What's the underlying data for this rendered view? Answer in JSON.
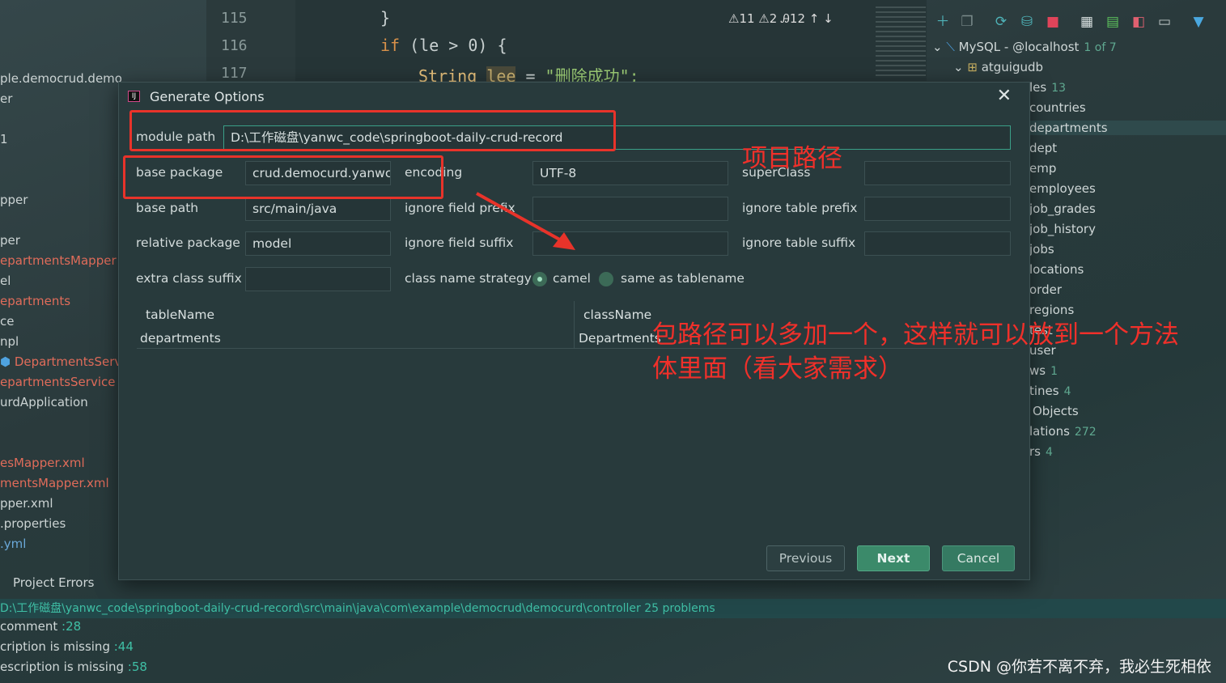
{
  "left_tree": [
    {
      "text": "ple.democrud.democurd",
      "color": "normal"
    },
    {
      "text": "er",
      "color": "normal"
    },
    {
      "text": "1",
      "color": "normal"
    },
    {
      "text": "pper",
      "color": "normal"
    },
    {
      "text": "per",
      "color": "normal"
    },
    {
      "text": "epartmentsMapper",
      "color": "red"
    },
    {
      "text": "el",
      "color": "normal"
    },
    {
      "text": "epartments",
      "color": "red"
    },
    {
      "text": "ce",
      "color": "normal"
    },
    {
      "text": "npl",
      "color": "normal"
    },
    {
      "text": "DepartmentsServic",
      "color": "red"
    },
    {
      "text": "epartmentsService",
      "color": "red"
    },
    {
      "text": "urdApplication",
      "color": "normal"
    },
    {
      "text": "esMapper.xml",
      "color": "red"
    },
    {
      "text": "mentsMapper.xml",
      "color": "red"
    },
    {
      "text": "pper.xml",
      "color": "normal"
    },
    {
      "text": ".properties",
      "color": "normal"
    },
    {
      "text": ".yml",
      "color": "blue"
    }
  ],
  "editor": {
    "line_numbers": [
      "115",
      "116",
      "117"
    ],
    "line1": "}",
    "line2_kw": "if",
    "line2_rest": " (le > 0) {",
    "line3_type": "String",
    "line3_var": "lee",
    "line3_eq": " = ",
    "line3_str": "\"删除成功\";",
    "warnings": "⚠11  ⚠2  Ꭿ12  ↑  ↓"
  },
  "db_panel": {
    "connection": "MySQL - @localhost",
    "connection_count": "1 of 7",
    "schema": "atguigudb",
    "items": [
      {
        "text": "les",
        "count": "13"
      },
      {
        "text": "countries",
        "count": ""
      },
      {
        "text": "departments",
        "count": "",
        "selected": true
      },
      {
        "text": "dept",
        "count": ""
      },
      {
        "text": "emp",
        "count": ""
      },
      {
        "text": "employees",
        "count": ""
      },
      {
        "text": "job_grades",
        "count": ""
      },
      {
        "text": "job_history",
        "count": ""
      },
      {
        "text": "jobs",
        "count": ""
      },
      {
        "text": "locations",
        "count": ""
      },
      {
        "text": "order",
        "count": ""
      },
      {
        "text": "regions",
        "count": ""
      },
      {
        "text": "test",
        "count": ""
      },
      {
        "text": "user",
        "count": ""
      },
      {
        "text": "ws",
        "count": "1"
      },
      {
        "text": "tines",
        "count": "4"
      },
      {
        "text": "Objects",
        "count": ""
      },
      {
        "text": "lations",
        "count": "272"
      },
      {
        "text": "rs",
        "count": "4"
      }
    ]
  },
  "bottom": {
    "tab": "Project Errors",
    "path": "D:\\工作磁盘\\yanwc_code\\springboot-daily-crud-record\\src\\main\\java\\com\\example\\democrud\\democurd\\controller  25 problems",
    "errors": [
      {
        "text": "comment",
        "line": ":28"
      },
      {
        "text": "cription is missing",
        "line": ":44"
      },
      {
        "text": "escription is missing",
        "line": ":58"
      }
    ]
  },
  "dialog": {
    "title": "Generate Options",
    "close": "✕",
    "module_path_label": "module path",
    "module_path_value": "D:\\工作磁盘\\yanwc_code\\springboot-daily-crud-record",
    "base_package_label": "base package",
    "base_package_value": "crud.democurd.yanwc",
    "encoding_label": "encoding",
    "encoding_value": "UTF-8",
    "superclass_label": "superClass",
    "superclass_value": "",
    "base_path_label": "base path",
    "base_path_value": "src/main/java",
    "ignore_field_prefix_label": "ignore field prefix",
    "ignore_field_prefix_value": "",
    "ignore_table_prefix_label": "ignore table prefix",
    "ignore_table_prefix_value": "",
    "relative_package_label": "relative package",
    "relative_package_value": "model",
    "ignore_field_suffix_label": "ignore field suffix",
    "ignore_field_suffix_value": "",
    "ignore_table_suffix_label": "ignore table suffix",
    "ignore_table_suffix_value": "",
    "extra_class_suffix_label": "extra class suffix",
    "extra_class_suffix_value": "",
    "class_name_strategy_label": "class name strategy",
    "strategy_camel": "camel",
    "strategy_same": "same as tablename",
    "table": {
      "headers": [
        "tableName",
        "className"
      ],
      "rows": [
        [
          "departments",
          "Departments"
        ]
      ]
    },
    "buttons": {
      "previous": "Previous",
      "next": "Next",
      "cancel": "Cancel"
    }
  },
  "annotations": {
    "project_path": "项目路径",
    "package_note_line1": "包路径可以多加一个，这样就可以放到一个方法",
    "package_note_line2": "体里面（看大家需求）"
  },
  "watermark": "CSDN @你若不离不弃，我必生死相依",
  "colors": {
    "annotation": "#e8332a",
    "accent": "#3b8a6a",
    "db_count": "#5fa890"
  }
}
